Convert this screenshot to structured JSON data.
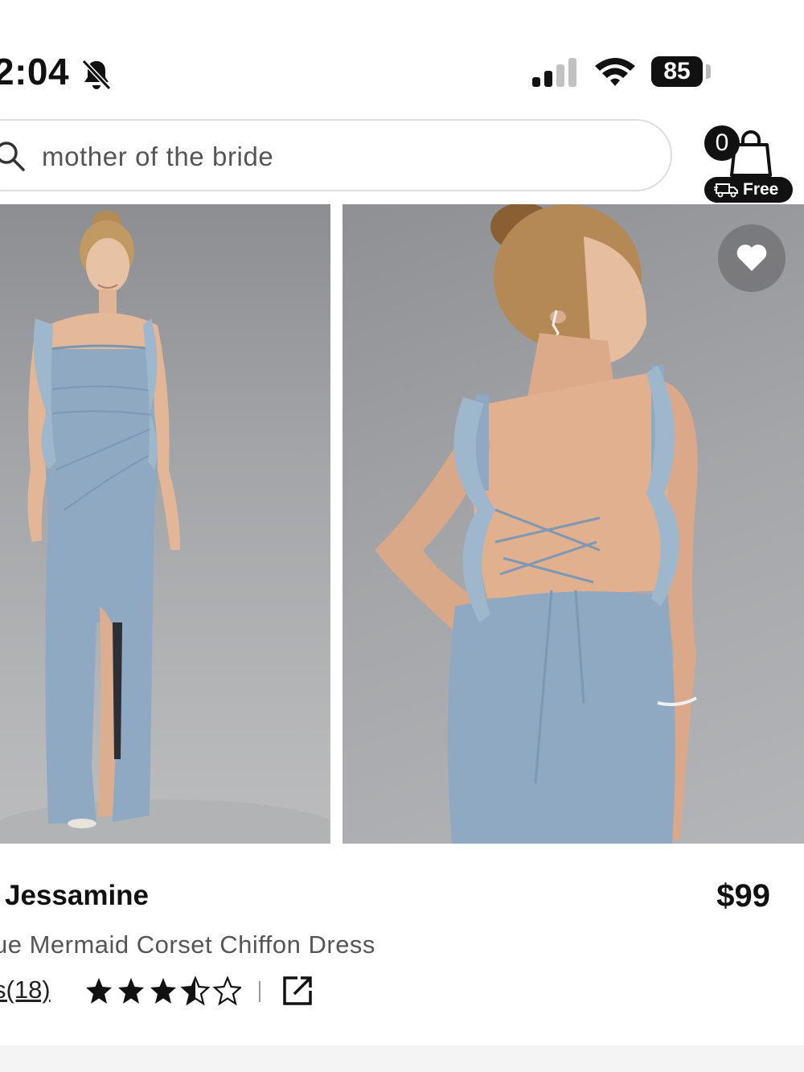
{
  "status_bar": {
    "time": "2:04",
    "battery": "85"
  },
  "search": {
    "value": "mother of the bride"
  },
  "cart": {
    "count": "0",
    "shipping_badge": "Free"
  },
  "product": {
    "brand": "Jessamine",
    "price": "$99",
    "title": "ue Mermaid Corset Chiffon Dress",
    "reviews_label": "s(18)",
    "rating": 3.5,
    "rating_max": 5
  },
  "icons": {
    "bell": "bell-muted-icon",
    "signal": "cellular-signal-icon",
    "wifi": "wifi-icon",
    "search": "search-icon",
    "cart": "shopping-bag-icon",
    "truck": "delivery-truck-icon",
    "heart": "heart-icon",
    "share": "share-icon"
  },
  "colors": {
    "text_primary": "#111111",
    "text_secondary": "#555555",
    "dress_blue": "#8fa9c3",
    "backdrop_grey": "#a4a6a9"
  }
}
